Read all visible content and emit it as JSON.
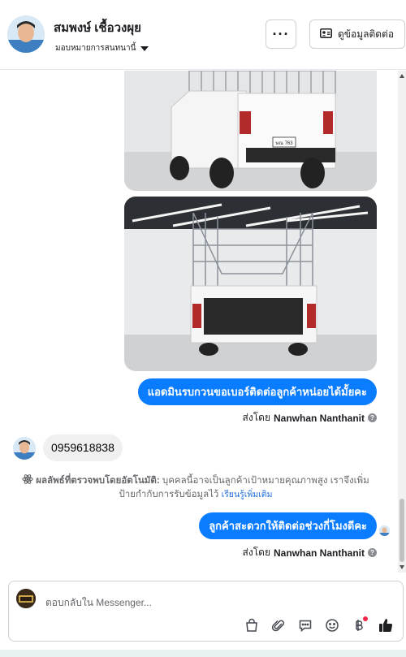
{
  "header": {
    "contact_name": "สมพงษ์ เชื้อวงผุย",
    "assign_label": "มอบหมายการสนทนานี้",
    "more_label": "···",
    "contact_button_label": "ดูข้อมูลติดต่อ"
  },
  "thread": {
    "outgoing_message_1": "แอดมินรบกวนขอเบอร์ติดต่อลูกค้าหน่อยได้มั้ยคะ",
    "sent_by_prefix_1": "ส่งโดย",
    "sent_by_name_1": "Nanwhan Nanthanit",
    "incoming_message": "0959618838",
    "auto_detect_title": "ผลลัพธ์ที่ตรวจพบโดยอัตโนมัติ:",
    "auto_detect_text": "บุคคลนี้อาจเป็นลูกค้าเป้าหมายคุณภาพสูง เราจึงเพิ่มป้ายกำกับการรับข้อมูลไว้",
    "learn_more": "เรียนรู้เพิ่มเติม",
    "outgoing_message_2": "ลูกค้าสะดวกให้ติดต่อช่วงกี่โมงดีคะ",
    "sent_by_prefix_2": "ส่งโดย",
    "sent_by_name_2": "Nanwhan Nanthanit",
    "plate_text": "ษณ 763"
  },
  "composer": {
    "placeholder": "ตอบกลับใน Messenger..."
  },
  "colors": {
    "accent": "#0a7cff",
    "incoming_bubble": "#f0f0f0",
    "link": "#216fdb",
    "notification": "#f02849"
  },
  "icons": [
    "more-icon",
    "contact-card-icon",
    "atom-icon",
    "info-icon",
    "bag-icon",
    "paperclip-icon",
    "chat-icon",
    "emoji-icon",
    "baht-icon",
    "thumbs-up-icon"
  ]
}
